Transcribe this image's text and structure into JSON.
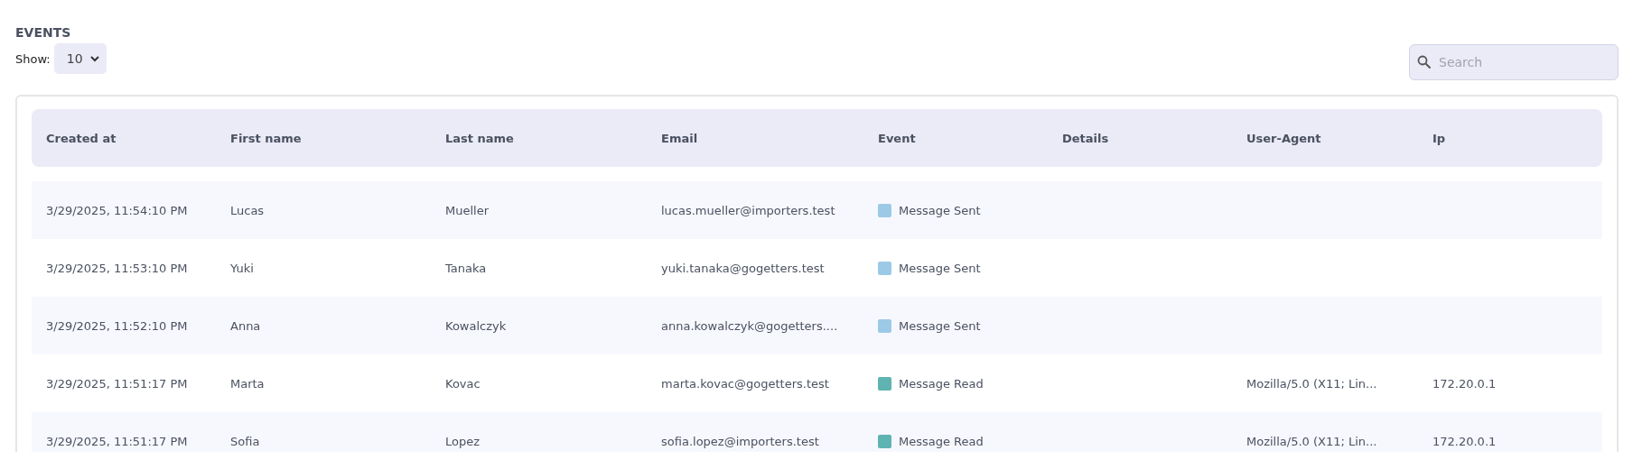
{
  "title": "EVENTS",
  "show": {
    "label": "Show:",
    "value": "10"
  },
  "search": {
    "placeholder": "Search"
  },
  "table": {
    "columns": [
      "Created at",
      "First name",
      "Last name",
      "Email",
      "Event",
      "Details",
      "User-Agent",
      "Ip"
    ],
    "rows": [
      {
        "created_at": "3/29/2025, 11:54:10 PM",
        "first_name": "Lucas",
        "last_name": "Mueller",
        "email": "lucas.mueller@importers.test",
        "event": {
          "label": "Message Sent",
          "color": "#9ccae6"
        },
        "details": "",
        "user_agent": "",
        "ip": ""
      },
      {
        "created_at": "3/29/2025, 11:53:10 PM",
        "first_name": "Yuki",
        "last_name": "Tanaka",
        "email": "yuki.tanaka@gogetters.test",
        "event": {
          "label": "Message Sent",
          "color": "#9ccae6"
        },
        "details": "",
        "user_agent": "",
        "ip": ""
      },
      {
        "created_at": "3/29/2025, 11:52:10 PM",
        "first_name": "Anna",
        "last_name": "Kowalczyk",
        "email": "anna.kowalczyk@gogetters....",
        "event": {
          "label": "Message Sent",
          "color": "#9ccae6"
        },
        "details": "",
        "user_agent": "",
        "ip": ""
      },
      {
        "created_at": "3/29/2025, 11:51:17 PM",
        "first_name": "Marta",
        "last_name": "Kovac",
        "email": "marta.kovac@gogetters.test",
        "event": {
          "label": "Message Read",
          "color": "#5fb3b0"
        },
        "details": "",
        "user_agent": "Mozilla/5.0 (X11; Lin...",
        "ip": "172.20.0.1"
      },
      {
        "created_at": "3/29/2025, 11:51:17 PM",
        "first_name": "Sofia",
        "last_name": "Lopez",
        "email": "sofia.lopez@importers.test",
        "event": {
          "label": "Message Read",
          "color": "#5fb3b0"
        },
        "details": "",
        "user_agent": "Mozilla/5.0 (X11; Lin...",
        "ip": "172.20.0.1"
      }
    ]
  }
}
